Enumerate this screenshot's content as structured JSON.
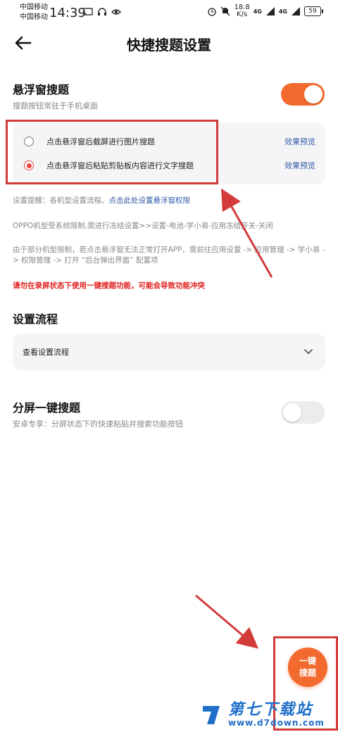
{
  "status_bar": {
    "carrier1": "中国移动",
    "carrier2": "中国移动",
    "time": "14:39",
    "speed_value": "18.8",
    "speed_unit": "K/s",
    "net1": "4G",
    "net2": "4G",
    "battery": "59"
  },
  "header": {
    "title": "快捷搜题设置"
  },
  "float_section": {
    "title": "悬浮窗搜题",
    "subtitle": "搜题按钮常驻于手机桌面",
    "toggle_on": true,
    "options": [
      {
        "label": "点击悬浮窗后截屏进行图片搜题",
        "preview": "效果预览",
        "selected": false
      },
      {
        "label": "点击悬浮窗后粘贴剪贴板内容进行文字搜题",
        "preview": "效果预览",
        "selected": true
      }
    ]
  },
  "hints": {
    "setup_prefix": "设置提醒：各机型设置流程。",
    "setup_link": "点击此处设置悬浮窗权限",
    "oppo": "OPPO机型受系统限制,需进行冻结设置>>设置-电池-学小易-应用冻结开关-关闭",
    "limit": "由于部分机型限制，若点击悬浮窗无法正常打开APP，需前往应用设置 -> 应用管理 -> 学小易 -> 权限管理 -> 打开 “后台弹出界面” 配置项",
    "warning": "请勿在录屏状态下使用一键搜题功能，可能会导致功能冲突"
  },
  "flow_section": {
    "title": "设置流程",
    "dropdown_label": "查看设置流程"
  },
  "split_section": {
    "title": "分屏一键搜题",
    "subtitle": "安卓专享：分屏状态下的快速粘贴并搜索功能按钮",
    "toggle_on": false
  },
  "fab": {
    "line1": "一键",
    "line2": "搜题"
  },
  "watermark": {
    "name": "第七下载站",
    "url": "www.d7down.com"
  },
  "colors": {
    "accent": "#f26a2e",
    "link": "#2f5aa8",
    "warning": "#e02020",
    "annotation": "#d33b3b"
  }
}
